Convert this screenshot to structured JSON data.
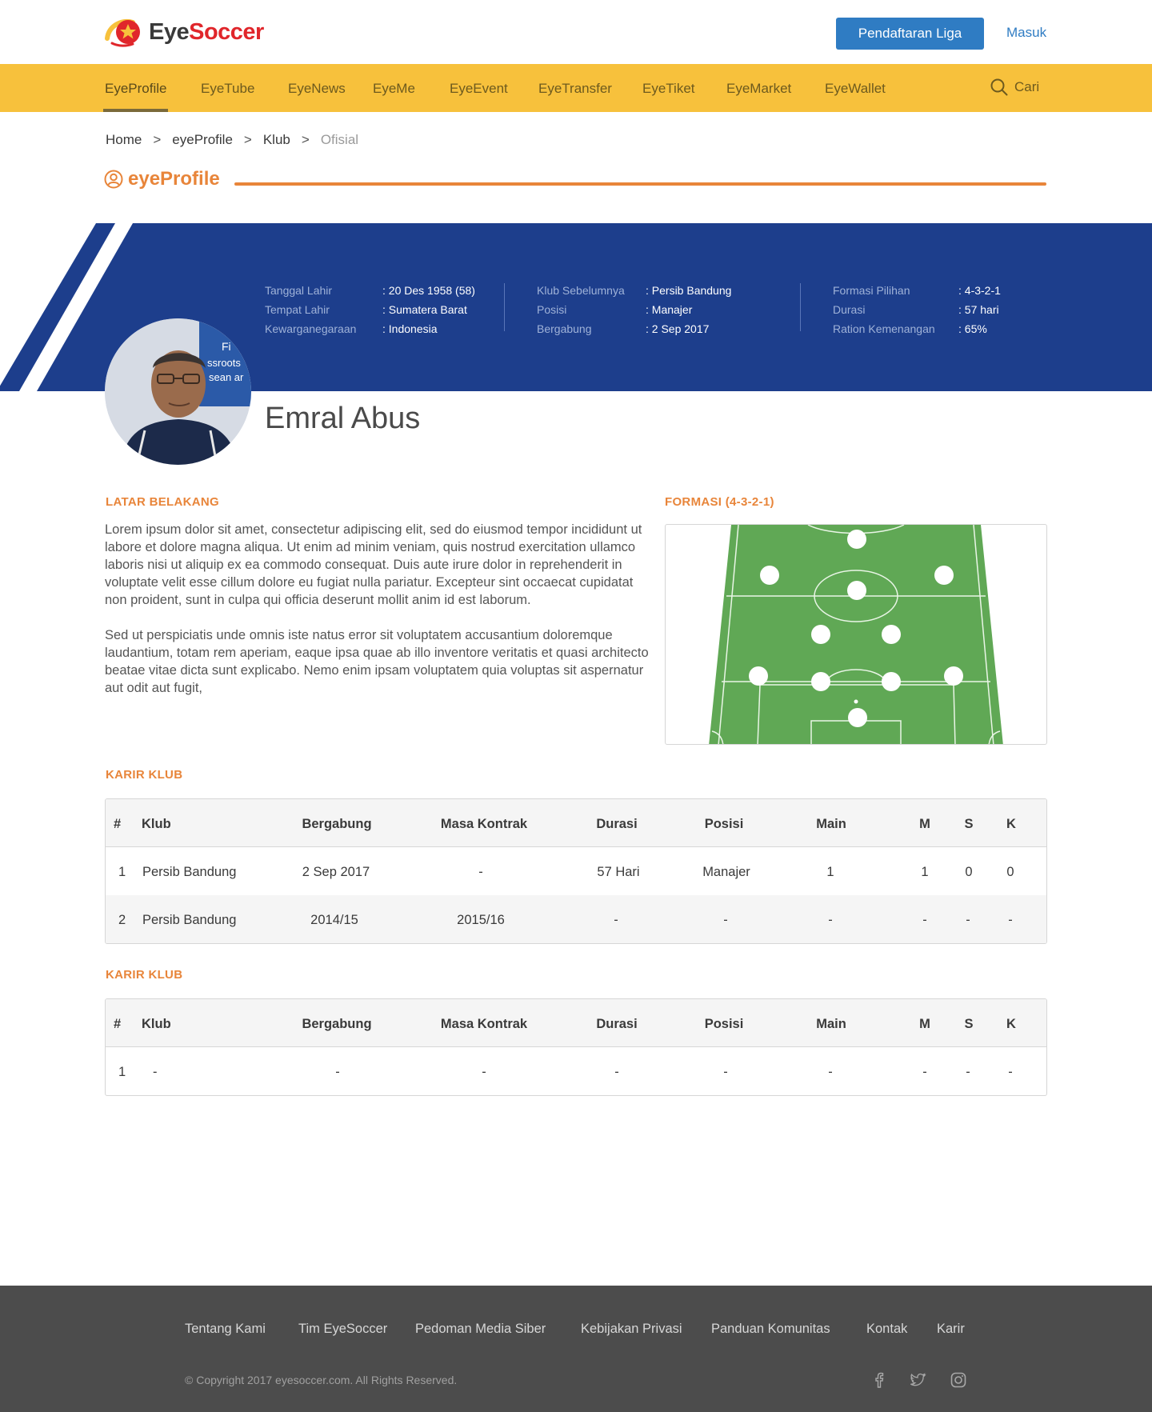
{
  "header": {
    "logo_eye": "Eye",
    "logo_soccer": "Soccer",
    "register_label": "Pendaftaran Liga",
    "login_label": "Masuk"
  },
  "nav": {
    "items": [
      "EyeProfile",
      "EyeTube",
      "EyeNews",
      "EyeMe",
      "EyeEvent",
      "EyeTransfer",
      "EyeTiket",
      "EyeMarket",
      "EyeWallet"
    ],
    "active": "EyeProfile",
    "search_label": "Cari"
  },
  "breadcrumb": {
    "items": [
      "Home",
      "eyeProfile",
      "Klub"
    ],
    "separator": ">",
    "current": "Ofisial"
  },
  "section": {
    "title": "eyeProfile"
  },
  "profile": {
    "name": "Emral Abus",
    "columns": [
      [
        {
          "label": "Tanggal Lahir",
          "value": ": 20 Des 1958 (58)"
        },
        {
          "label": "Tempat Lahir",
          "value": ": Sumatera Barat"
        },
        {
          "label": "Kewarganegaraan",
          "value": ": Indonesia"
        }
      ],
      [
        {
          "label": "Klub Sebelumnya",
          "value": ": Persib Bandung"
        },
        {
          "label": "Posisi",
          "value": ": Manajer"
        },
        {
          "label": "Bergabung",
          "value": ": 2 Sep 2017"
        }
      ],
      [
        {
          "label": "Formasi Pilihan",
          "value": ": 4-3-2-1"
        },
        {
          "label": "Durasi",
          "value": ": 57 hari"
        },
        {
          "label": "Ration Kemenangan",
          "value": ": 65%"
        }
      ]
    ],
    "photo_text": [
      "Fi",
      "ssroots",
      "sean ar"
    ]
  },
  "background": {
    "heading": "LATAR BELAKANG",
    "paragraphs": [
      "Lorem ipsum dolor sit amet, consectetur adipiscing elit, sed do eiusmod tempor incididunt ut labore et dolore magna aliqua. Ut enim ad minim veniam, quis nostrud exercitation ullamco laboris nisi ut aliquip ex ea commodo consequat. Duis aute irure dolor in reprehenderit in voluptate velit esse cillum dolore eu fugiat nulla pariatur. Excepteur sint occaecat cupidatat non proident, sunt in culpa qui officia deserunt mollit anim id est laborum.",
      "Sed ut perspiciatis unde omnis iste natus error sit voluptatem accusantium doloremque laudantium, totam rem aperiam, eaque ipsa quae ab illo inventore veritatis et quasi architecto beatae vitae dicta sunt explicabo. Nemo enim ipsam voluptatem quia voluptas sit aspernatur aut odit aut fugit,"
    ]
  },
  "formation": {
    "heading": "FORMASI (4-3-2-1)",
    "colors": {
      "pitch": "#60a855",
      "lines": "#e9f5e6",
      "player": "#ffffff"
    }
  },
  "career_tables": [
    {
      "heading": "KARIR KLUB",
      "columns": [
        "#",
        "Klub",
        "Bergabung",
        "Masa Kontrak",
        "Durasi",
        "Posisi",
        "Main",
        "M",
        "S",
        "K"
      ],
      "rows": [
        [
          "1",
          "Persib Bandung",
          "2 Sep 2017",
          "-",
          "57 Hari",
          "Manajer",
          "1",
          "1",
          "0",
          "0"
        ],
        [
          "2",
          "Persib Bandung",
          "2014/15",
          "2015/16",
          "-",
          "-",
          "-",
          "-",
          "-",
          "-"
        ]
      ]
    },
    {
      "heading": "KARIR KLUB",
      "columns": [
        "#",
        "Klub",
        "Bergabung",
        "Masa Kontrak",
        "Durasi",
        "Posisi",
        "Main",
        "M",
        "S",
        "K"
      ],
      "rows": [
        [
          "1",
          "-",
          "-",
          "-",
          "-",
          "-",
          "-",
          "-",
          "-",
          "-"
        ]
      ]
    }
  ],
  "footer": {
    "links": [
      "Tentang Kami",
      "Tim EyeSoccer",
      "Pedoman Media Siber",
      "Kebijakan Privasi",
      "Panduan Komunitas",
      "Kontak",
      "Karir"
    ],
    "copyright": "© Copyright 2017 eyesoccer.com. All Rights Reserved.",
    "social_icons": [
      "facebook-icon",
      "twitter-icon",
      "instagram-icon"
    ]
  },
  "colors": {
    "brand_orange": "#e8853a",
    "nav_yellow": "#f7c13c",
    "banner_blue": "#1d3e8c",
    "button_blue": "#2f7cc3",
    "footer_gray": "#4c4c4c"
  }
}
